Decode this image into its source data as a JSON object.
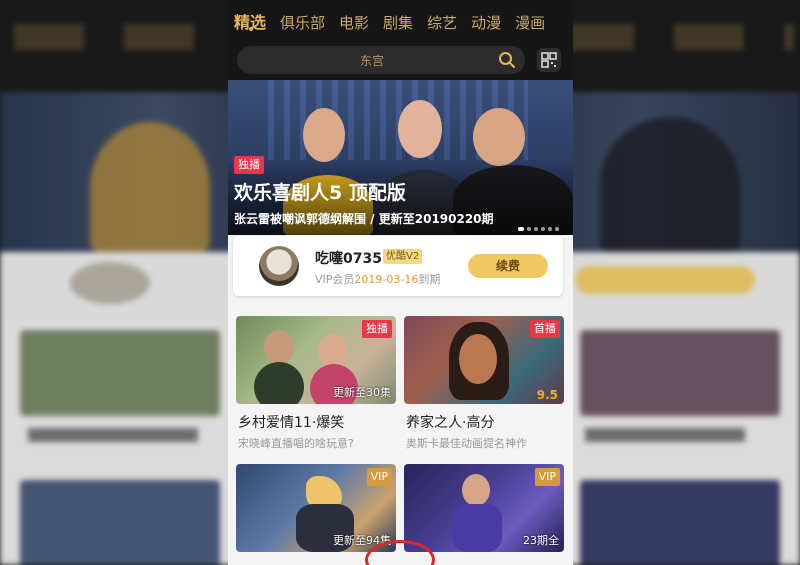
{
  "tabs": [
    "精选",
    "俱乐部",
    "电影",
    "剧集",
    "综艺",
    "动漫",
    "漫画"
  ],
  "search": {
    "placeholder": "东宫"
  },
  "hero": {
    "badge": "独播",
    "title": "欢乐喜剧人5 顶配版",
    "subtitle": "张云雷被嘲讽郭德纲解围 / 更新至20190220期",
    "dots": 6
  },
  "vip": {
    "username": "吃噻0735",
    "tag": "优酷V2",
    "prefix": "VIP会员",
    "date": "2019-03-16",
    "suffix": "到期",
    "button": "续费"
  },
  "cards": [
    {
      "corner": "独播",
      "corner_color": "#e8364a",
      "update": "更新至30集",
      "title": "乡村爱情11·爆笑",
      "desc": "宋晓峰直播唱的啥玩意?"
    },
    {
      "corner": "首播",
      "corner_color": "#e8364a",
      "score": "9.5",
      "title": "养家之人·高分",
      "desc": "奥斯卡最佳动画提名神作"
    },
    {
      "corner": "VIP",
      "corner_color": "#d59b3c",
      "update": "更新至94集",
      "title": "",
      "desc": ""
    },
    {
      "corner": "VIP",
      "corner_color": "#d59b3c",
      "update": "23期全",
      "title": "",
      "desc": ""
    }
  ],
  "colors": {
    "accent_gold": "#e7b75b",
    "badge_red": "#e8364a",
    "highlight_circle": "#e0262e"
  }
}
